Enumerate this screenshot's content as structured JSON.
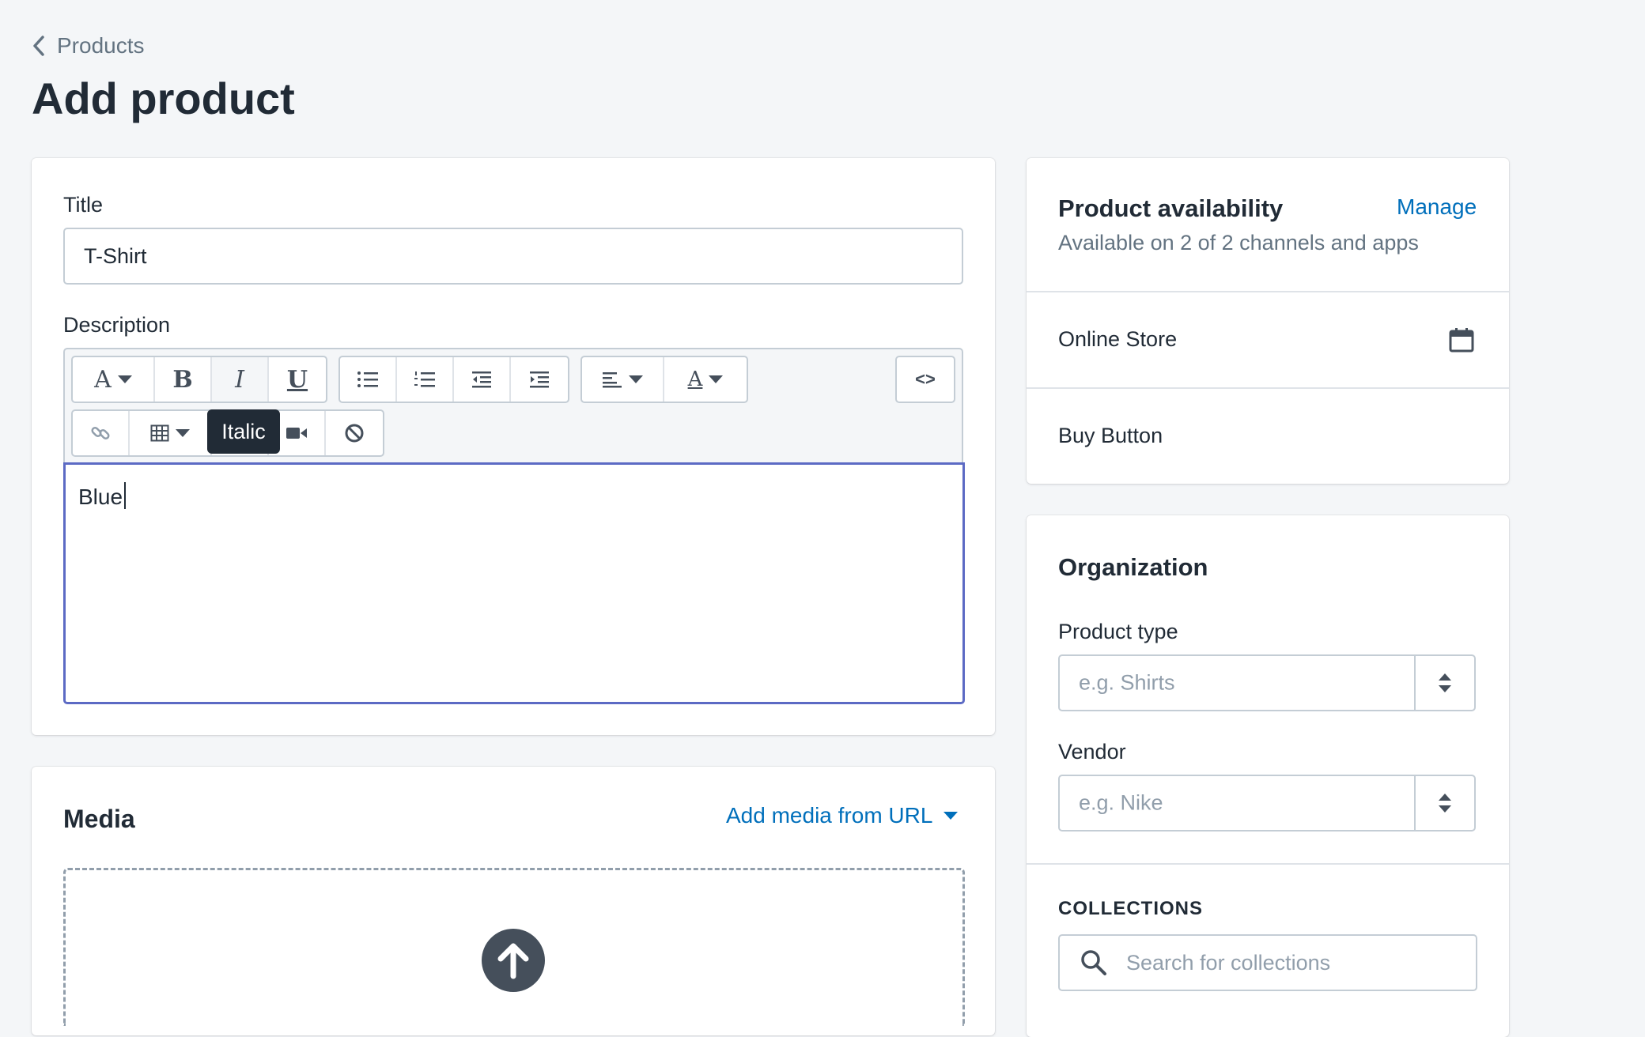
{
  "breadcrumb": {
    "label": "Products"
  },
  "page": {
    "title": "Add product"
  },
  "general": {
    "title_label": "Title",
    "title_value": "T-Shirt",
    "description_label": "Description",
    "description_text": "Blue",
    "tooltip": "Italic",
    "toolbar": {
      "font_glyph": "A",
      "bold_glyph": "B",
      "italic_glyph": "I",
      "underline_glyph": "U",
      "color_glyph": "A",
      "html_glyph": "<>"
    }
  },
  "media": {
    "title": "Media",
    "add_from_url": "Add media from URL"
  },
  "availability": {
    "title": "Product availability",
    "manage": "Manage",
    "subtitle": "Available on 2 of 2 channels and apps",
    "channels": [
      "Online Store",
      "Buy Button"
    ]
  },
  "organization": {
    "title": "Organization",
    "product_type_label": "Product type",
    "product_type_placeholder": "e.g. Shirts",
    "vendor_label": "Vendor",
    "vendor_placeholder": "e.g. Nike",
    "collections_label": "COLLECTIONS",
    "collections_placeholder": "Search for collections"
  },
  "colors": {
    "accent": "#5c6ac4",
    "link": "#006fbb",
    "background": "#f4f6f8"
  }
}
